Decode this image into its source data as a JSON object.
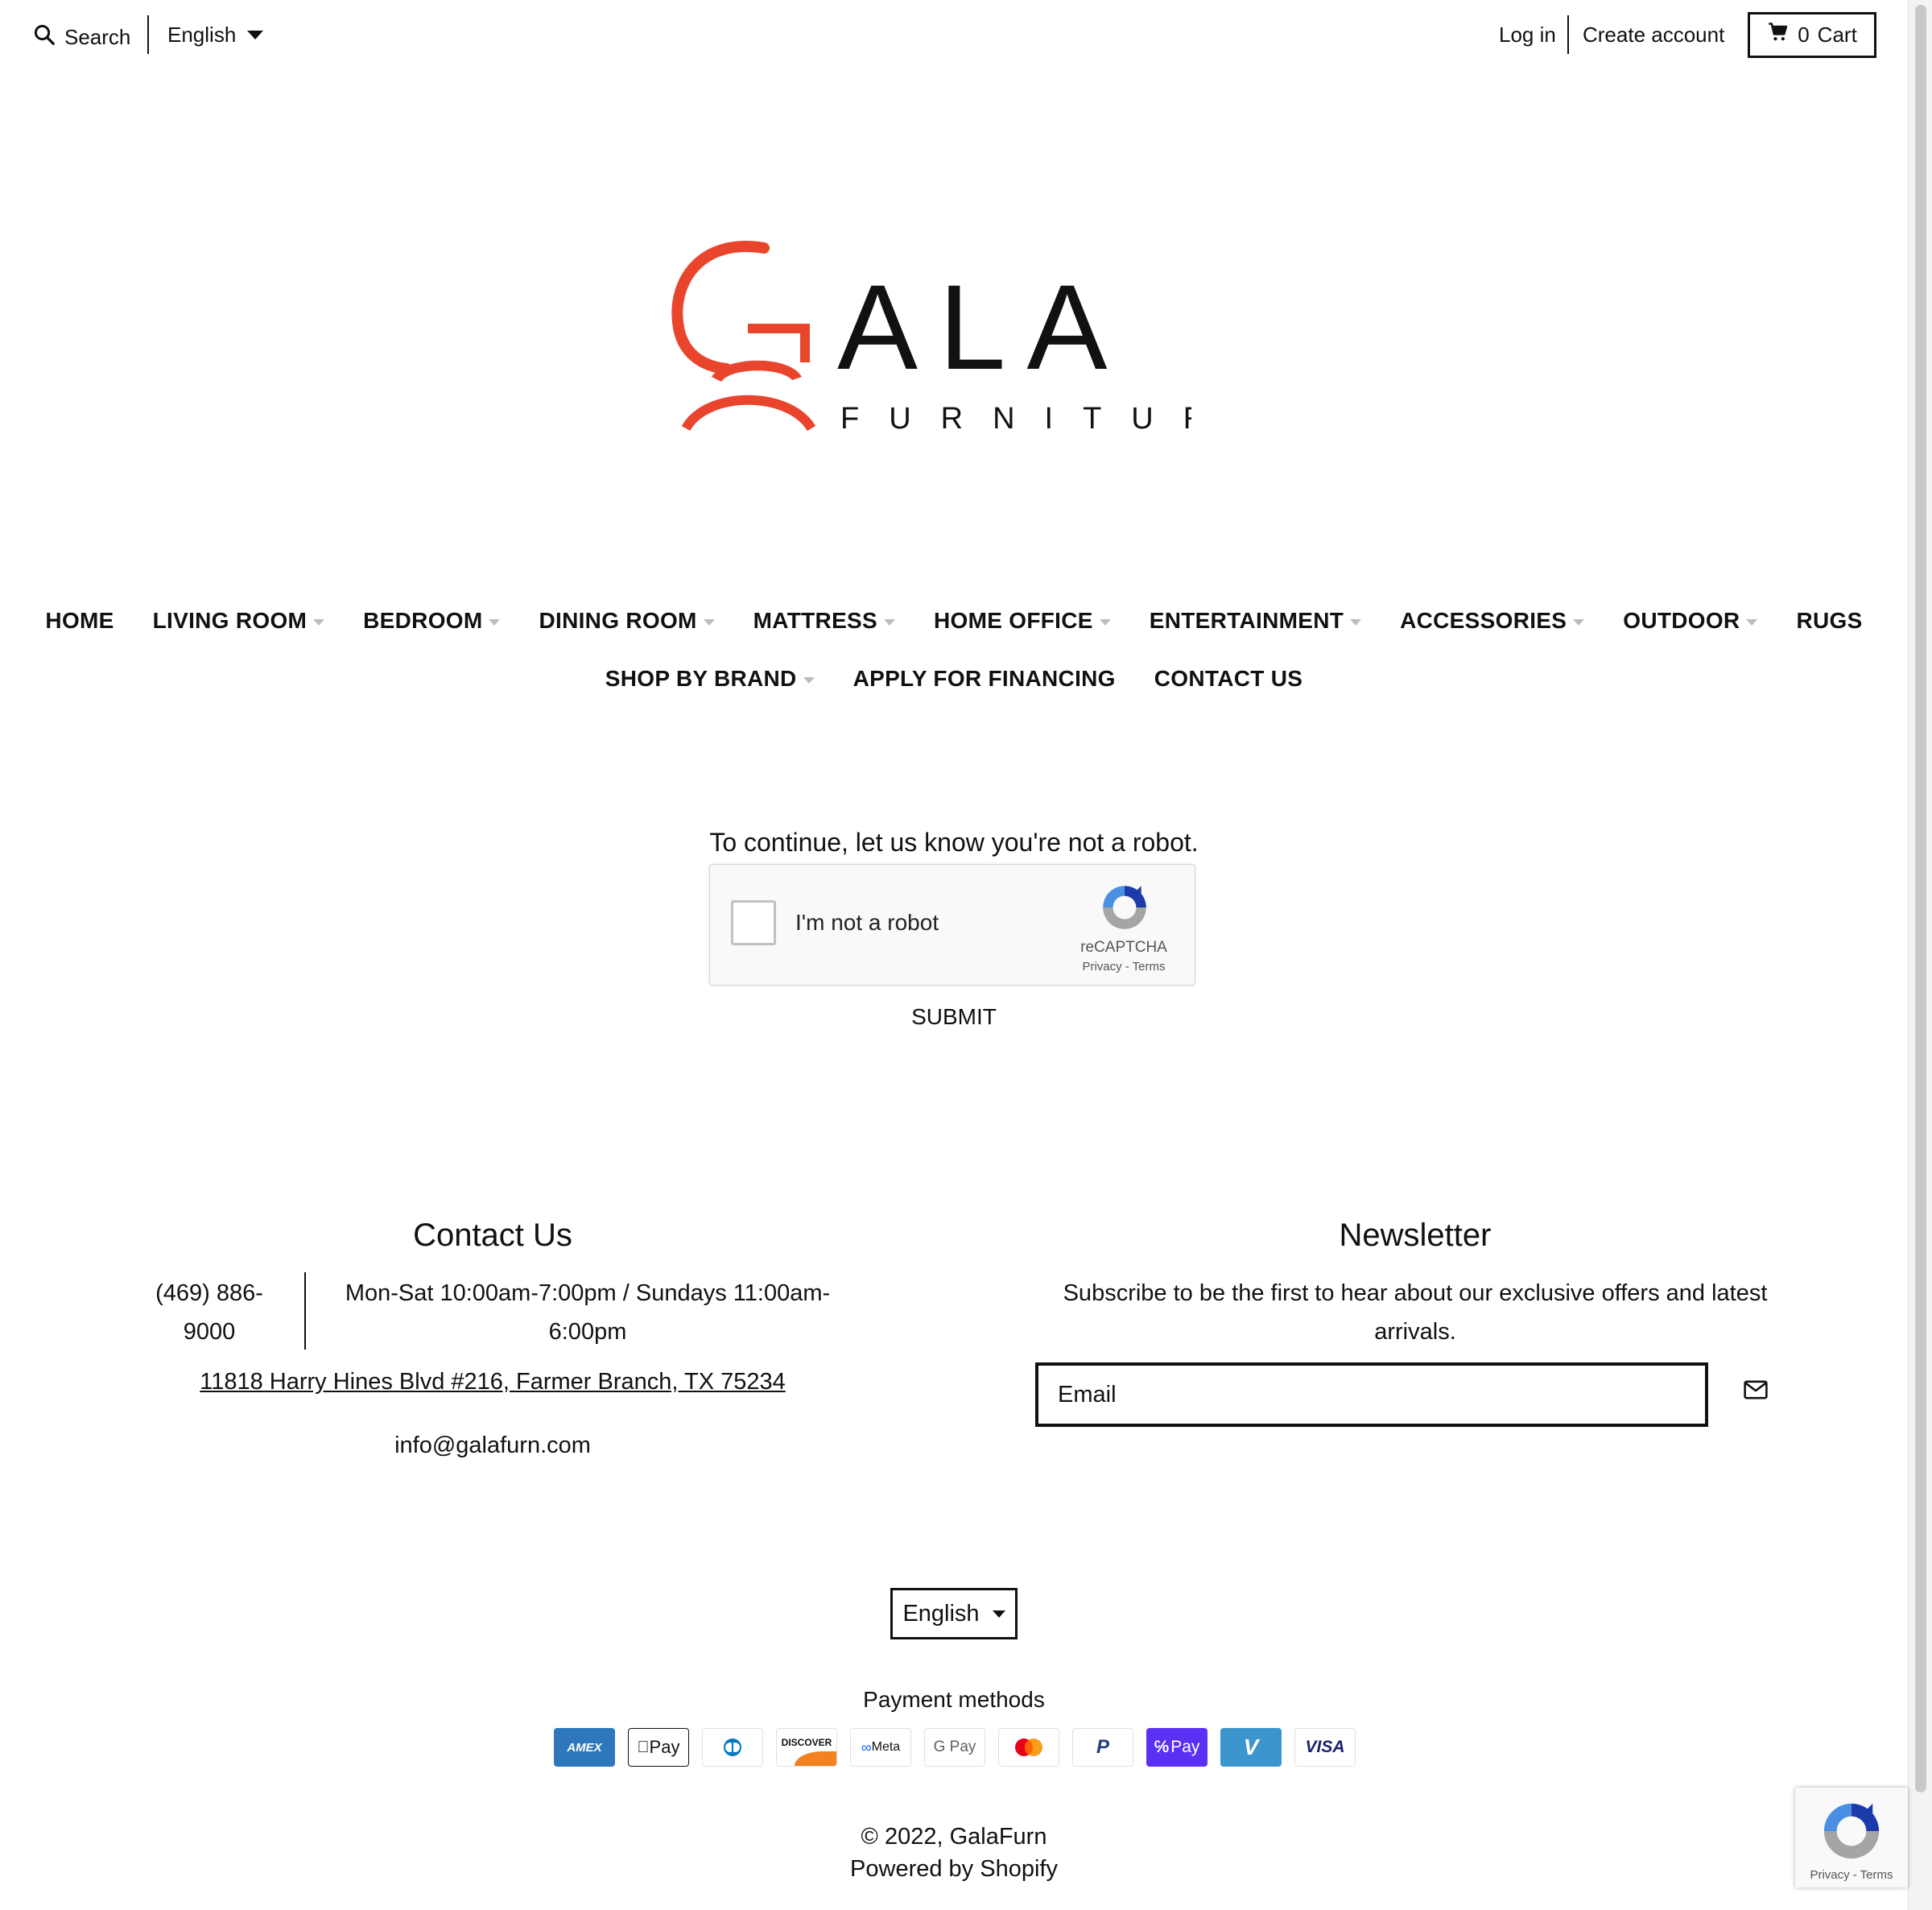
{
  "topbar": {
    "search_label": "Search",
    "language": "English",
    "login": "Log in",
    "create_account": "Create account",
    "cart_count": "0",
    "cart_label": "Cart"
  },
  "logo": {
    "wordmark": "ALA",
    "tagline": "FURNITURE"
  },
  "nav": {
    "row1": [
      {
        "label": "HOME",
        "has_dropdown": false
      },
      {
        "label": "LIVING ROOM",
        "has_dropdown": true
      },
      {
        "label": "BEDROOM",
        "has_dropdown": true
      },
      {
        "label": "DINING ROOM",
        "has_dropdown": true
      },
      {
        "label": "MATTRESS",
        "has_dropdown": true
      },
      {
        "label": "HOME OFFICE",
        "has_dropdown": true
      },
      {
        "label": "ENTERTAINMENT",
        "has_dropdown": true
      },
      {
        "label": "ACCESSORIES",
        "has_dropdown": true
      },
      {
        "label": "OUTDOOR",
        "has_dropdown": true
      },
      {
        "label": "RUGS",
        "has_dropdown": false
      }
    ],
    "row2": [
      {
        "label": "SHOP BY BRAND",
        "has_dropdown": true
      },
      {
        "label": "APPLY FOR FINANCING",
        "has_dropdown": false
      },
      {
        "label": "CONTACT US",
        "has_dropdown": false
      }
    ]
  },
  "captcha": {
    "prompt": "To continue, let us know you're not a robot.",
    "checkbox_label": "I'm not a robot",
    "brand": "reCAPTCHA",
    "links": "Privacy - Terms",
    "submit": "SUBMIT"
  },
  "contact": {
    "title": "Contact Us",
    "phone_line1": "(469) 886-",
    "phone_line2": "9000",
    "hours_line1": "Mon-Sat 10:00am-7:00pm / Sundays 11:00am-",
    "hours_line2": "6:00pm",
    "address": "11818 Harry Hines Blvd #216, Farmer Branch, TX 75234",
    "email": "info@galafurn.com"
  },
  "newsletter": {
    "title": "Newsletter",
    "text_line1": "Subscribe to be the first to hear about our exclusive offers and latest",
    "text_line2": "arrivals.",
    "email_placeholder": "Email"
  },
  "footer": {
    "language": "English",
    "payment_title": "Payment methods",
    "payment_methods": [
      {
        "name": "amex",
        "label": "AMEX"
      },
      {
        "name": "apple-pay",
        "label": "Pay"
      },
      {
        "name": "diners-club",
        "label": ""
      },
      {
        "name": "discover",
        "label": "DISCOVER"
      },
      {
        "name": "meta-pay",
        "label": "Meta"
      },
      {
        "name": "google-pay",
        "label": "G Pay"
      },
      {
        "name": "mastercard",
        "label": ""
      },
      {
        "name": "paypal",
        "label": "P"
      },
      {
        "name": "shop-pay",
        "label": "Pay"
      },
      {
        "name": "venmo",
        "label": "V"
      },
      {
        "name": "visa",
        "label": "VISA"
      }
    ],
    "copyright": "© 2022, GalaFurn",
    "powered_by": "Powered by Shopify"
  },
  "recaptcha_badge": {
    "links": "Privacy - Terms"
  },
  "colors": {
    "brand_orange": "#E8452C",
    "text": "#111111",
    "amex": "#2E77BC",
    "shop_pay": "#5A31F4",
    "venmo": "#3D95CE",
    "visa": "#1A1F71"
  }
}
